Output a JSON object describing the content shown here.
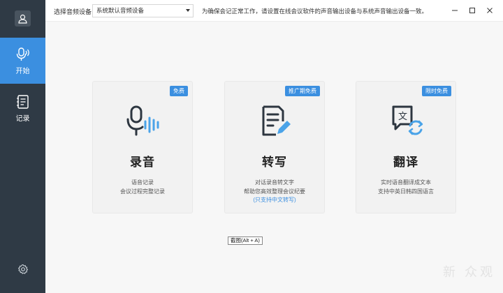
{
  "topbar": {
    "device_label": "选择音频设备",
    "device_select_value": "系统默认音频设备",
    "tip": "为确保会记正常工作，请设置在线会议软件的声音输出设备与系统声音输出设备一致。"
  },
  "sidebar": {
    "items": [
      {
        "label": "开始",
        "icon": "mic-wave-icon",
        "active": true
      },
      {
        "label": "记录",
        "icon": "notebook-icon",
        "active": false
      }
    ]
  },
  "cards": [
    {
      "badge": "免费",
      "title": "录音",
      "desc": [
        "语音记录",
        "会议过程完整记录"
      ],
      "note": "",
      "icon": "microphone-icon"
    },
    {
      "badge": "推广期免费",
      "title": "转写",
      "desc": [
        "对话录音转文字",
        "帮助您高效整理会议纪要"
      ],
      "note": "(只支持中文转写)",
      "icon": "document-pen-icon"
    },
    {
      "badge": "限时免费",
      "title": "翻译",
      "desc": [
        "实时语音翻译成文本",
        "支持中英日韩四国语言"
      ],
      "note": "",
      "icon": "translate-icon"
    }
  ],
  "tooltip": "截图(Alt + A)",
  "watermark": "新 众观",
  "colors": {
    "accent": "#3b8fe0",
    "sidebar": "#2f3a45"
  }
}
